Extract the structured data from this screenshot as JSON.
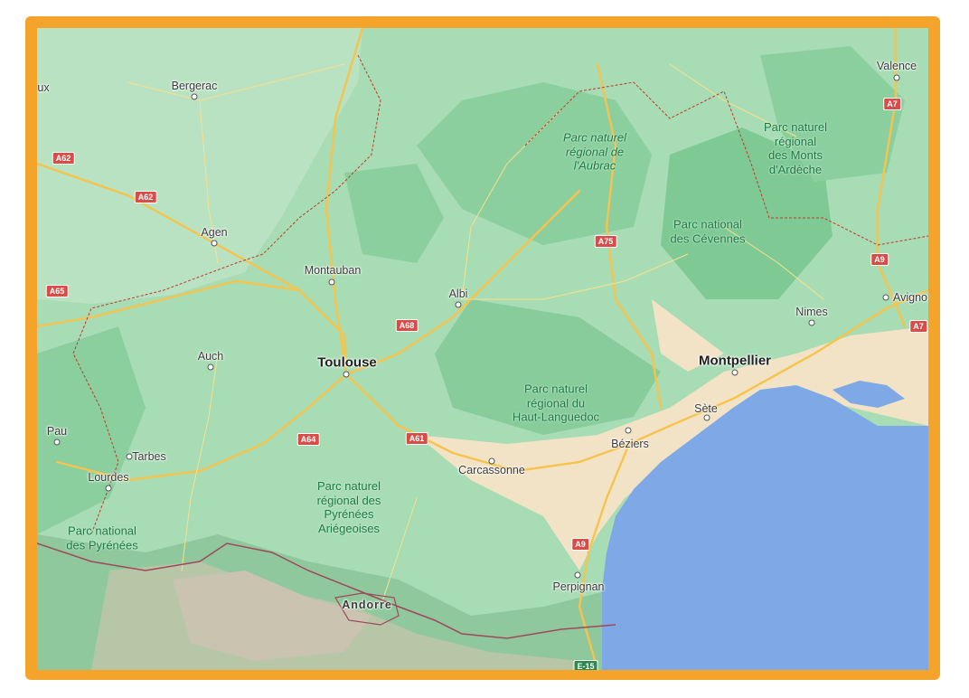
{
  "colors": {
    "frame": "#f5a42b",
    "sea": "#7fa9e6",
    "land": "#a8dcb5",
    "forest": "#7fc995",
    "road": "#f6c34c",
    "motorway_shield": "#d94c48",
    "border": "#c0392b"
  },
  "cities": {
    "aux": "ux",
    "bergerac": "Bergerac",
    "valence": "Valence",
    "agen": "Agen",
    "montauban": "Montauban",
    "albi": "Albi",
    "avignon": "Avigno",
    "nimes": "Nimes",
    "auch": "Auch",
    "toulouse": "Toulouse",
    "montpellier": "Montpellier",
    "sete": "Sète",
    "beziers": "Béziers",
    "pau": "Pau",
    "tarbes": "Tarbes",
    "lourdes": "Lourdes",
    "carcassonne": "Carcassonne",
    "perpignan": "Perpignan",
    "andorre": "Andorre"
  },
  "parks": {
    "aubrac": "Parc naturel\nrégional de\nl'Aubrac",
    "ardeche": "Parc naturel\nrégional\ndes Monts\nd'Ardèche",
    "cevennes": "Parc national\ndes Cévennes",
    "languedoc": "Parc naturel\nrégional du\nHaut-Languedoc",
    "ariegeoises": "Parc naturel\nrégional des\nPyrénées\nAriégeoises",
    "pyrenees": "Parc national\ndes Pyrénées"
  },
  "roads": {
    "a62a": "A62",
    "a62b": "A62",
    "a65": "A65",
    "a7a": "A7",
    "a7b": "A7",
    "a75": "A75",
    "a9a": "A9",
    "a9b": "A9",
    "a68": "A68",
    "a64": "A64",
    "a61": "A61",
    "e15": "E-15"
  }
}
